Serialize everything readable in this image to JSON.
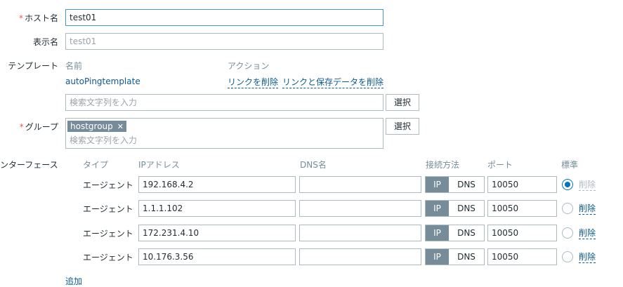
{
  "hostname": {
    "label": "ホスト名",
    "value": "test01"
  },
  "displayname": {
    "label": "表示名",
    "placeholder": "test01"
  },
  "templates": {
    "label": "テンプレート",
    "col_name": "名前",
    "col_action": "アクション",
    "items": [
      {
        "name": "autoPingtemplate",
        "unlink": "リンクを削除",
        "unlink_clear": "リンクと保存データを削除"
      }
    ],
    "search_placeholder": "検索文字列を入力",
    "select_button": "選択"
  },
  "groups": {
    "label": "グループ",
    "tags": [
      "hostgroup"
    ],
    "search_placeholder": "検索文字列を入力",
    "select_button": "選択"
  },
  "interfaces": {
    "label": "ンターフェース",
    "headers": {
      "type": "タイプ",
      "ip": "IPアドレス",
      "dns": "DNS名",
      "connect": "接続方法",
      "port": "ポート",
      "default": "標準"
    },
    "connect_ip_label": "IP",
    "connect_dns_label": "DNS",
    "remove_label": "削除",
    "rows": [
      {
        "type": "エージェント",
        "ip": "192.168.4.2",
        "dns": "",
        "connect": "IP",
        "port": "10050",
        "default": true
      },
      {
        "type": "エージェント",
        "ip": "1.1.1.102",
        "dns": "",
        "connect": "IP",
        "port": "10050",
        "default": false
      },
      {
        "type": "エージェント",
        "ip": "172.231.4.10",
        "dns": "",
        "connect": "IP",
        "port": "10050",
        "default": false
      },
      {
        "type": "エージェント",
        "ip": "10.176.3.56",
        "dns": "",
        "connect": "IP",
        "port": "10050",
        "default": false
      }
    ],
    "add_label": "追加"
  },
  "colors": {
    "link": "#0b5a8f",
    "required": "#e45959",
    "segment_active": "#768d99",
    "radio_checked": "#0275b8",
    "focus_border": "#4796c4"
  }
}
